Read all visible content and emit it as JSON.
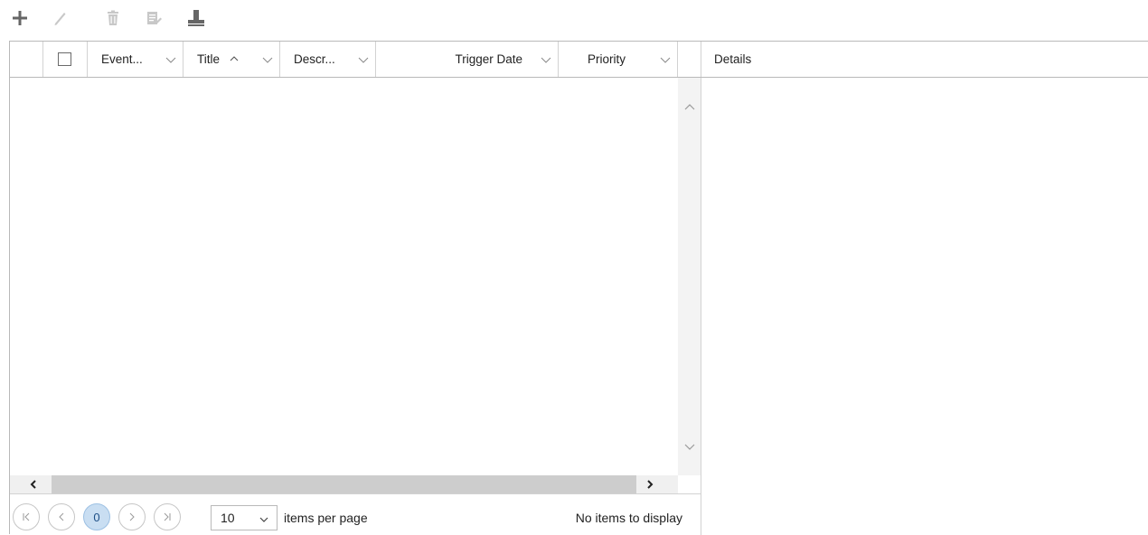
{
  "toolbar": {
    "buttons": [
      {
        "name": "add",
        "icon": "plus-icon",
        "enabled": true
      },
      {
        "name": "edit",
        "icon": "pencil-icon",
        "enabled": false
      },
      {
        "name": "delete",
        "icon": "trash-icon",
        "enabled": false
      },
      {
        "name": "edit-details",
        "icon": "notepad-icon",
        "enabled": false
      },
      {
        "name": "stamp",
        "icon": "stamp-icon",
        "enabled": true
      }
    ]
  },
  "grid": {
    "columns": [
      {
        "label": "Event...",
        "filter_icon": "chevron-down-icon"
      },
      {
        "label": "Title",
        "sort": "ascending",
        "sort_icon": "caret-up-icon",
        "filter_icon": "chevron-down-icon"
      },
      {
        "label": "Descr...",
        "filter_icon": "chevron-down-icon"
      },
      {
        "label": "Trigger Date",
        "filter_icon": "chevron-down-icon"
      },
      {
        "label": "Priority",
        "filter_icon": "chevron-down-icon"
      }
    ],
    "details_header": "Details",
    "rows": []
  },
  "pager": {
    "current_page": "0",
    "page_size": "10",
    "items_per_page_label": "items per page",
    "status": "No items to display"
  },
  "colors": {
    "border": "#b9b9b9",
    "current_page_bg": "#c9def2",
    "icon_enabled": "#6b6b6b",
    "icon_disabled": "#c8c8c8"
  }
}
